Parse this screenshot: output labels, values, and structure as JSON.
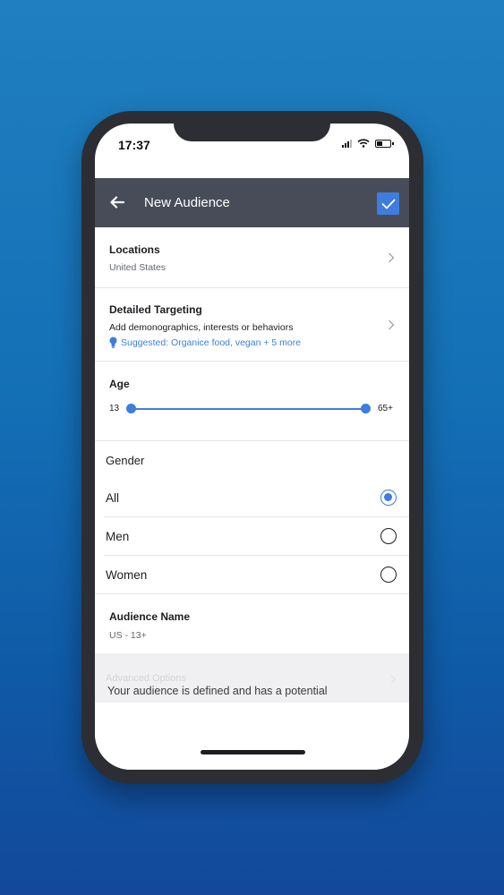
{
  "status_bar": {
    "time": "17:37"
  },
  "header": {
    "title": "New Audience"
  },
  "locations": {
    "label": "Locations",
    "value": "United States"
  },
  "detailed_targeting": {
    "label": "Detailed Targeting",
    "description": "Add demonographics, interests or behaviors",
    "suggestion": "Suggested: Organice food, vegan + 5 more"
  },
  "age": {
    "label": "Age",
    "min_label": "13",
    "max_label": "65+"
  },
  "gender": {
    "label": "Gender",
    "options": [
      {
        "label": "All",
        "selected": true
      },
      {
        "label": "Men",
        "selected": false
      },
      {
        "label": "Women",
        "selected": false
      }
    ]
  },
  "audience_name": {
    "label": "Audience Name",
    "value": "US  - 13+"
  },
  "advanced_options": {
    "label": "Advanced Options"
  },
  "potential_text": "Your audience is defined and has a potential",
  "colors": {
    "accent": "#3d7de0",
    "header_bg": "#484c59",
    "background": "#146fb5"
  }
}
